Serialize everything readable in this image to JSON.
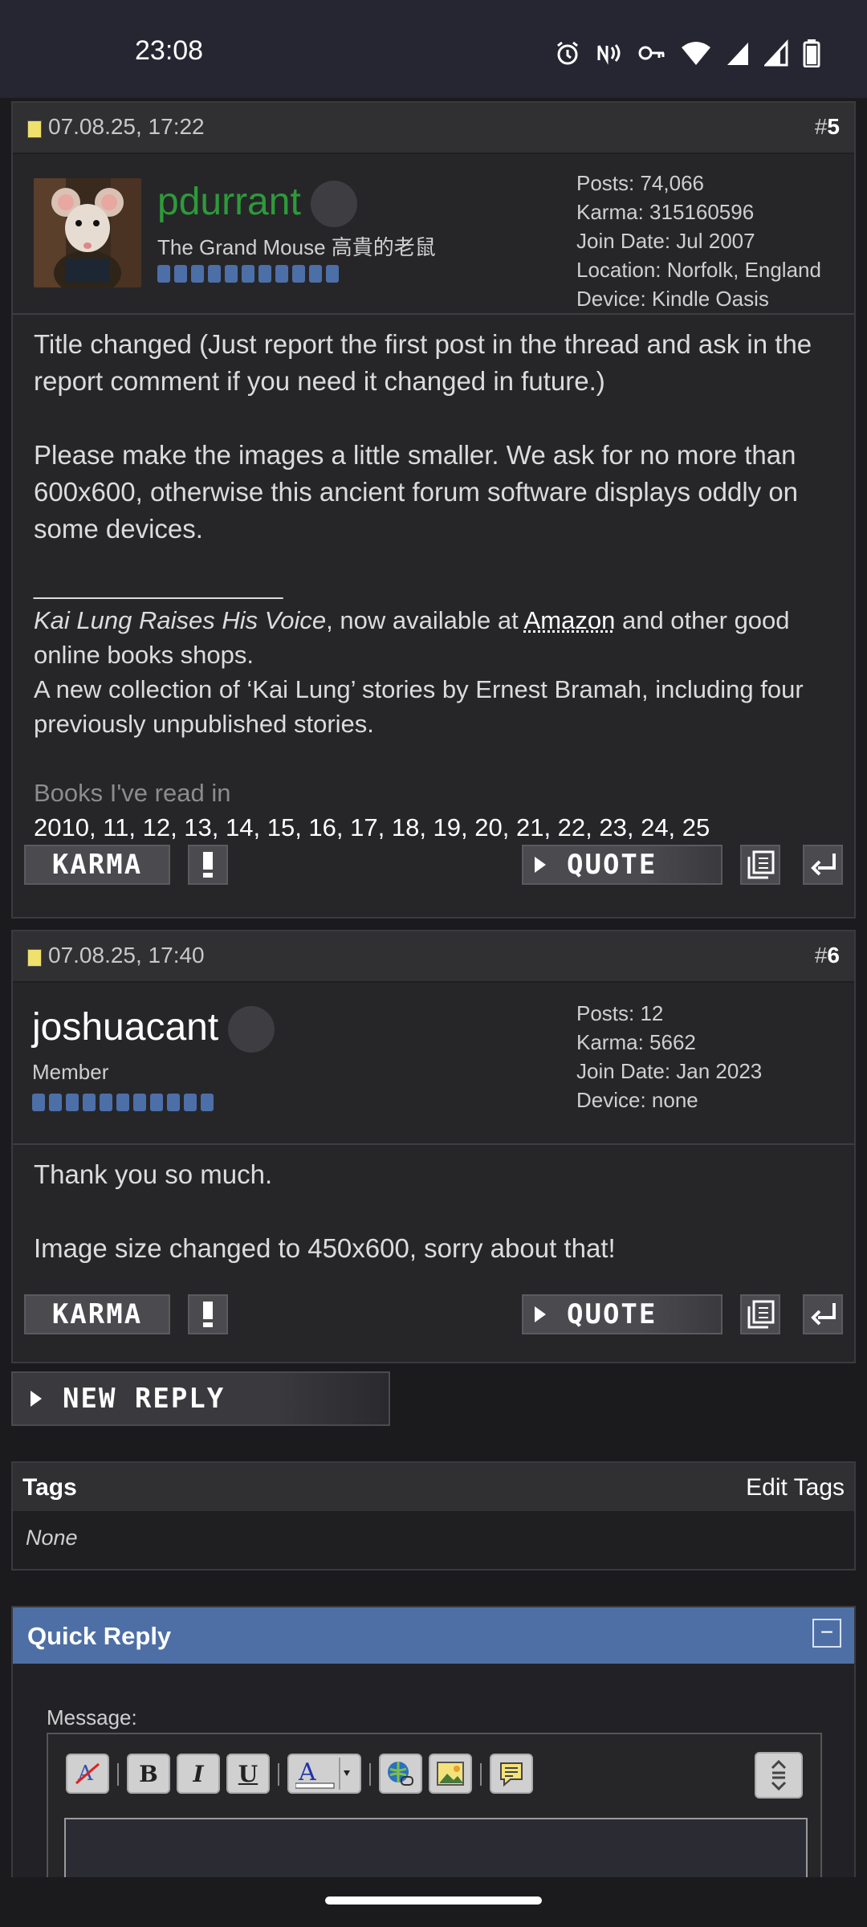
{
  "status": {
    "time": "23:08"
  },
  "posts": [
    {
      "date": "07.08.25, 17:22",
      "hash": "#",
      "num": "5",
      "username": "pdurrant",
      "user_title": "The Grand Mouse 高貴的老鼠",
      "stats": [
        "Posts: 74,066",
        "Karma: 315160596",
        "Join Date: Jul 2007",
        "Location: Norfolk, England",
        "Device: Kindle Oasis"
      ],
      "para1": "Title changed (Just report the first post in the thread and ask in the report comment if you need it changed in future.)",
      "para2": "Please make the images a little smaller. We ask for no more than 600x600, otherwise this ancient forum software displays oddly on some devices.",
      "sig_rule": "__________________",
      "sig_book": "Kai Lung Raises His Voice",
      "sig_mid": ", now available at ",
      "sig_link": "Amazon",
      "sig_end": " and other good online books shops.",
      "sig_line2": "A new collection of ‘Kai Lung’ stories by Ernest Bramah, including four previously unpublished stories.",
      "books_label": "Books I've read in",
      "years": "2010, 11, 12, 13, 14, 15, 16, 17, 18, 19, 20, 21, 22, 23, 24, 25"
    },
    {
      "date": "07.08.25, 17:40",
      "hash": "#",
      "num": "6",
      "username": "joshuacant",
      "user_title": "Member",
      "stats": [
        "Posts: 12",
        "Karma: 5662",
        "Join Date: Jan 2023",
        "Device: none"
      ],
      "para1": "Thank you so much.",
      "para2": "Image size changed to 450x600, sorry about that!"
    }
  ],
  "buttons": {
    "karma": "KARMA",
    "quote": "QUOTE",
    "new_reply": "NEW REPLY"
  },
  "tags": {
    "title": "Tags",
    "edit": "Edit Tags",
    "value": "None"
  },
  "quick_reply": {
    "title": "Quick Reply",
    "message_label": "Message:"
  },
  "colors": {
    "accent": "#4e6fa6",
    "username_green": "#2e9a3a",
    "reputation": "#4c6fa8"
  }
}
